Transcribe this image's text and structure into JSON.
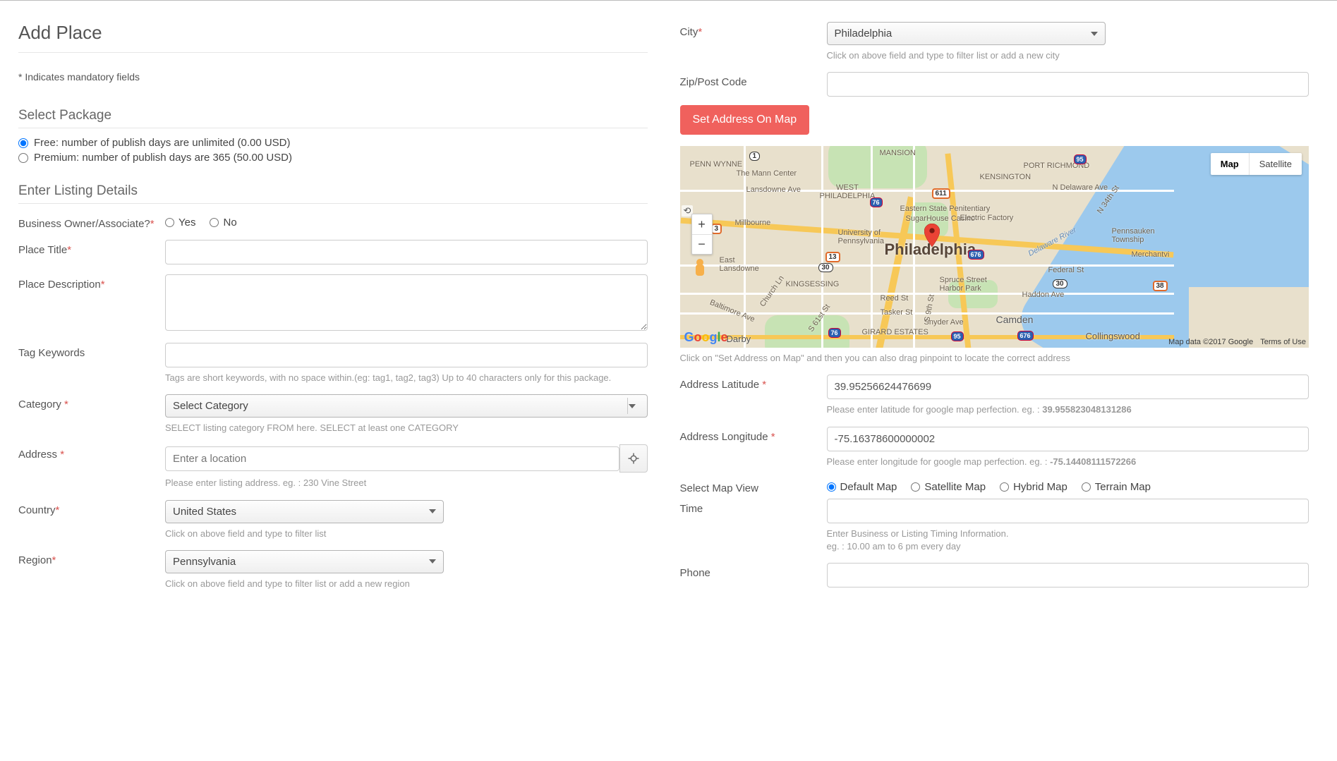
{
  "page": {
    "title": "Add Place",
    "mandatory_note": "* Indicates mandatory fields"
  },
  "package": {
    "section_title": "Select Package",
    "options": [
      {
        "id": "pkg-free",
        "label": "Free: number of publish days are unlimited (0.00 USD)",
        "selected": true
      },
      {
        "id": "pkg-premium",
        "label": "Premium: number of publish days are 365 (50.00 USD)",
        "selected": false
      }
    ]
  },
  "listing": {
    "section_title": "Enter Listing Details",
    "owner": {
      "label": "Business Owner/Associate?",
      "yes": "Yes",
      "no": "No"
    },
    "place_title": {
      "label": "Place Title"
    },
    "place_description": {
      "label": "Place Description"
    },
    "tags": {
      "label": "Tag Keywords",
      "help": "Tags are short keywords, with no space within.(eg: tag1, tag2, tag3) Up to 40 characters only for this package."
    },
    "category": {
      "label": "Category",
      "selected": "Select Category",
      "help": "SELECT listing category FROM here. SELECT at least one CATEGORY"
    },
    "address": {
      "label": "Address",
      "placeholder": "Enter a location",
      "help": "Please enter listing address. eg. : 230 Vine Street"
    },
    "country": {
      "label": "Country",
      "selected": "United States",
      "help": "Click on above field and type to filter list"
    },
    "region": {
      "label": "Region",
      "selected": "Pennsylvania",
      "help": "Click on above field and type to filter list or add a new region"
    }
  },
  "right": {
    "city": {
      "label": "City",
      "selected": "Philadelphia",
      "help": "Click on above field and type to filter list or add a new city"
    },
    "zip": {
      "label": "Zip/Post Code",
      "value": ""
    },
    "set_address_btn": "Set Address On Map",
    "map": {
      "type_map": "Map",
      "type_sat": "Satellite",
      "city_label": "Philadelphia",
      "labels": {
        "penn_wynne": "PENN WYNNE",
        "mansion": "MANSION",
        "port_richmond": "PORT RICHMOND",
        "mann_center": "The Mann Center",
        "kensington": "KENSINGTON",
        "lansdowne_ave": "Lansdowne Ave",
        "west_phila": "WEST\nPHILADELPHIA",
        "delaware_ave": "N Delaware Ave",
        "millbourne": "Millbourne",
        "eastern_state": "Eastern State Penitentiary",
        "sugarhouse": "SugarHouse Casino",
        "electric_factory": "Electric Factory",
        "upenn": "University of\nPennsylvania",
        "pennsauken": "Pennsauken\nTownship",
        "east_lansdowne": "East\nLansdowne",
        "delaware_river": "Delaware River",
        "federal_st": "Federal St",
        "kingsessing": "KINGSESSING",
        "spruce_harbor": "Spruce Street\nHarbor Park",
        "haddon_ave": "Haddon Ave",
        "merchantvi": "Merchantvi",
        "reed_st": "Reed St",
        "tasker_st": "Tasker St",
        "snyder_ave": "Snyder Ave",
        "girard_estates": "GIRARD ESTATES",
        "camden": "Camden",
        "collingswood": "Collingswood",
        "darby": "Darby",
        "n34th": "N 34th St",
        "church_ln": "Church Ln",
        "baltimore_ave": "Baltimore Ave",
        "s61st": "S 61st St",
        "s9th": "S 9th St"
      },
      "routes": {
        "r1": "1",
        "r13": "13",
        "r30a": "30",
        "r611": "611",
        "r3": "3",
        "r676": "676",
        "r30b": "30",
        "r38": "38",
        "i95a": "95",
        "i76": "76",
        "i95b": "95",
        "i76b": "76",
        "i676": "676"
      },
      "zoom_in": "+",
      "zoom_out": "−",
      "attr_data": "Map data ©2017 Google",
      "attr_terms": "Terms of Use"
    },
    "map_help": "Click on \"Set Address on Map\" and then you can also drag pinpoint to locate the correct address",
    "lat": {
      "label": "Address Latitude",
      "value": "39.95256624476699",
      "help": "Please enter latitude for google map perfection. eg. :",
      "example": "39.955823048131286"
    },
    "lng": {
      "label": "Address Longitude",
      "value": "-75.16378600000002",
      "help": "Please enter longitude for google map perfection. eg. :",
      "example": "-75.14408111572266"
    },
    "mapview": {
      "label": "Select Map View",
      "options": {
        "default": "Default Map",
        "satellite": "Satellite Map",
        "hybrid": "Hybrid Map",
        "terrain": "Terrain Map"
      }
    },
    "time": {
      "label": "Time",
      "help_l1": "Enter Business or Listing Timing Information.",
      "help_l2": "eg. : 10.00 am to 6 pm every day"
    },
    "phone": {
      "label": "Phone"
    }
  }
}
